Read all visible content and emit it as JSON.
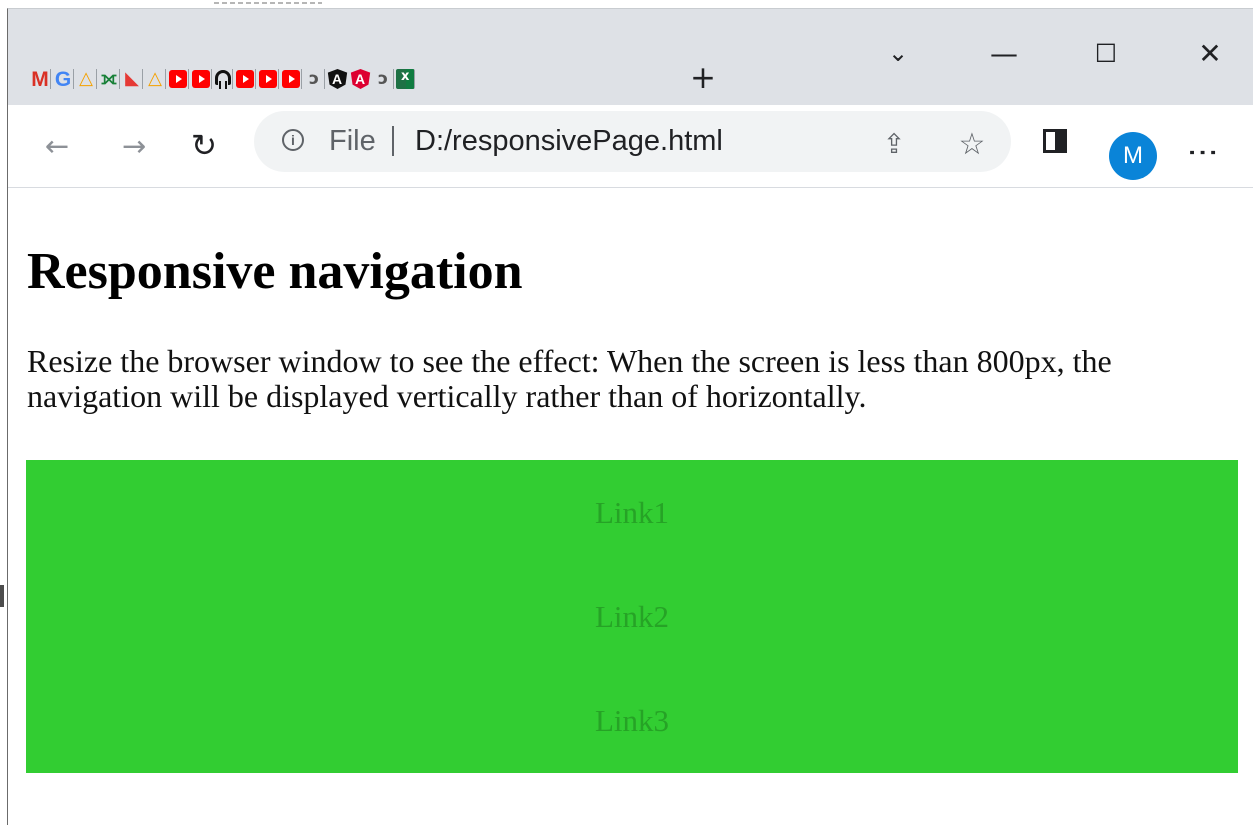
{
  "browser": {
    "tab_icons": [
      {
        "icon": "gmail-icon",
        "label": "M"
      },
      {
        "icon": "google-icon",
        "label": "G"
      },
      {
        "icon": "drive-icon",
        "label": "△"
      },
      {
        "icon": "ribbon-icon",
        "label": "⟗"
      },
      {
        "icon": "tomahawk-icon",
        "label": "◣"
      },
      {
        "icon": "drive-icon",
        "label": "△"
      },
      {
        "icon": "youtube-icon",
        "label": ""
      },
      {
        "icon": "youtube-icon",
        "label": ""
      },
      {
        "icon": "helmet-icon",
        "label": ""
      },
      {
        "icon": "youtube-icon",
        "label": ""
      },
      {
        "icon": "youtube-icon",
        "label": ""
      },
      {
        "icon": "youtube-icon",
        "label": ""
      },
      {
        "icon": "loop-icon",
        "label": "ↄ"
      },
      {
        "icon": "angular-dark-icon",
        "label": "A"
      },
      {
        "icon": "angular-red-icon",
        "label": "A"
      },
      {
        "icon": "loop-icon",
        "label": "ↄ"
      },
      {
        "icon": "excel-icon",
        "label": ""
      }
    ],
    "new_tab_label": "+",
    "tab_search_label": "⌄",
    "window_controls": {
      "minimize": "—",
      "maximize": "☐",
      "close": "✕"
    },
    "toolbar": {
      "back_label": "←",
      "forward_label": "→",
      "reload_label": "↻",
      "info_label": "i",
      "scheme": "File",
      "url": "D:/responsivePage.html",
      "share_label": "⇪",
      "bookmark_label": "☆",
      "profile_initial": "M",
      "menu_label": "⋮"
    },
    "colors": {
      "titlebar": "#dee1e6",
      "avatar": "#0a84d8",
      "omnibox": "#f1f3f4"
    }
  },
  "page": {
    "title": "Responsive navigation",
    "description": "Resize the browser window to see the effect: When the screen is less than 800px, the navigation will be displayed vertically rather than of horizontally.",
    "nav_background": "#32cd32",
    "links": [
      "Link1",
      "Link2",
      "Link3"
    ]
  }
}
